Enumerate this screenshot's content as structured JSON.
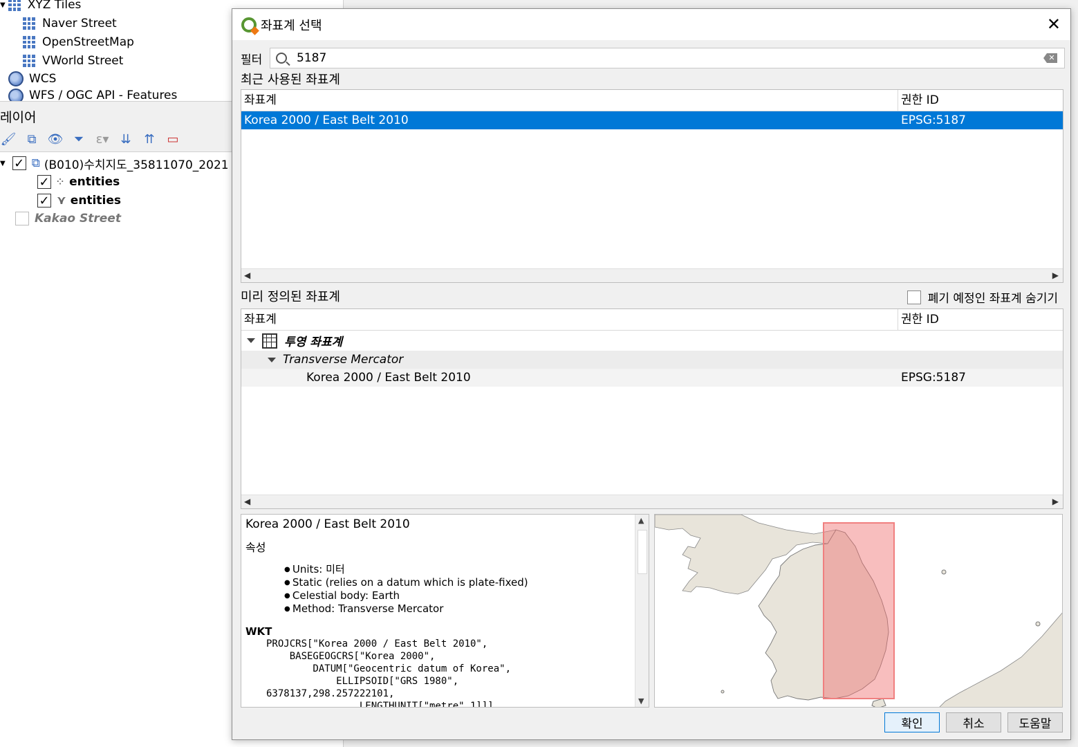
{
  "browser": {
    "items": [
      {
        "label": "XYZ Tiles"
      },
      {
        "label": "Naver Street"
      },
      {
        "label": "OpenStreetMap"
      },
      {
        "label": "VWorld Street"
      },
      {
        "label": "WCS"
      },
      {
        "label": "WFS / OGC API - Features"
      }
    ]
  },
  "layers": {
    "header": "레이어",
    "items": [
      {
        "label": "(B010)수치지도_35811070_2021"
      },
      {
        "label": "entities"
      },
      {
        "label": "entities"
      },
      {
        "label": "Kakao Street"
      }
    ]
  },
  "dialog": {
    "title": "좌표계 선택",
    "filter_label": "필터",
    "filter_value": "5187",
    "recent_label": "최근 사용된 좌표계",
    "predefined_label": "미리 정의된 좌표계",
    "hide_deprecated_label": "폐기 예정인 좌표계 숨기기",
    "col_crs": "좌표계",
    "col_authority": "권한 ID",
    "recent_rows": [
      {
        "name": "Korea 2000 / East Belt 2010",
        "auth": "EPSG:5187"
      }
    ],
    "tree": {
      "group": "투영 좌표계",
      "subgroup": "Transverse Mercator",
      "row": {
        "name": "Korea 2000 / East Belt 2010",
        "auth": "EPSG:5187"
      }
    },
    "details": {
      "title": "Korea 2000 / East Belt 2010",
      "props_heading": "속성",
      "props": [
        "Units: 미터",
        "Static (relies on a datum which is plate-fixed)",
        "Celestial body: Earth",
        "Method: Transverse Mercator"
      ],
      "wkt_heading": "WKT",
      "wkt": "PROJCRS[\"Korea 2000 / East Belt 2010\",\n    BASEGEOGCRS[\"Korea 2000\",\n        DATUM[\"Geocentric datum of Korea\",\n            ELLIPSOID[\"GRS 1980\",\n6378137,298.257222101,\n                LENGTHUNIT[\"metre\",1]]],"
    },
    "buttons": {
      "ok": "확인",
      "cancel": "취소",
      "help": "도움말"
    }
  }
}
